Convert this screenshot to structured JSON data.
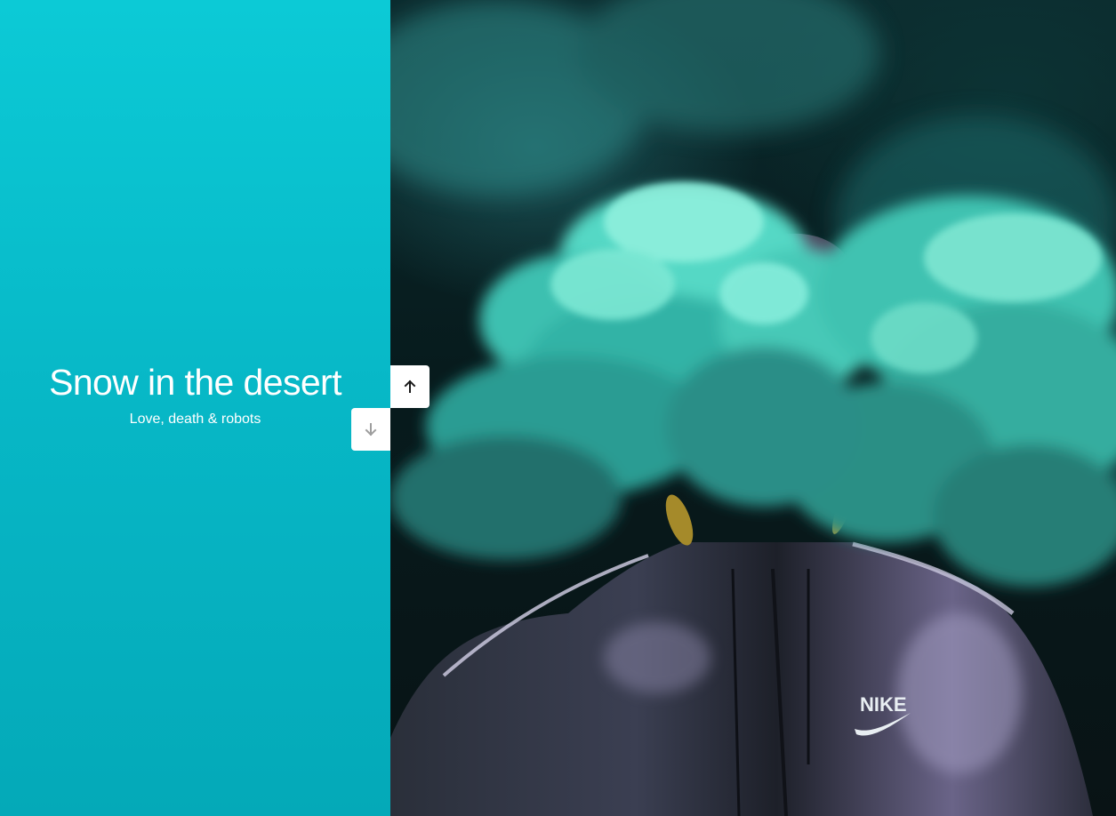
{
  "slide": {
    "title": "Snow in the desert",
    "subtitle": "Love, death & robots"
  },
  "photo": {
    "subject": "hooded figure in teal smoke",
    "brand_text": "NIKE"
  },
  "navigation": {
    "up_icon": "arrow-up-icon",
    "down_icon": "arrow-down-icon"
  },
  "colors": {
    "panel_top": "#0ccad6",
    "panel_bottom": "#04a9b8",
    "smoke": "#4fd6c4",
    "button_bg": "#ffffff",
    "arrow_active": "#1a1a1a",
    "arrow_inactive": "#9e9e9e"
  }
}
